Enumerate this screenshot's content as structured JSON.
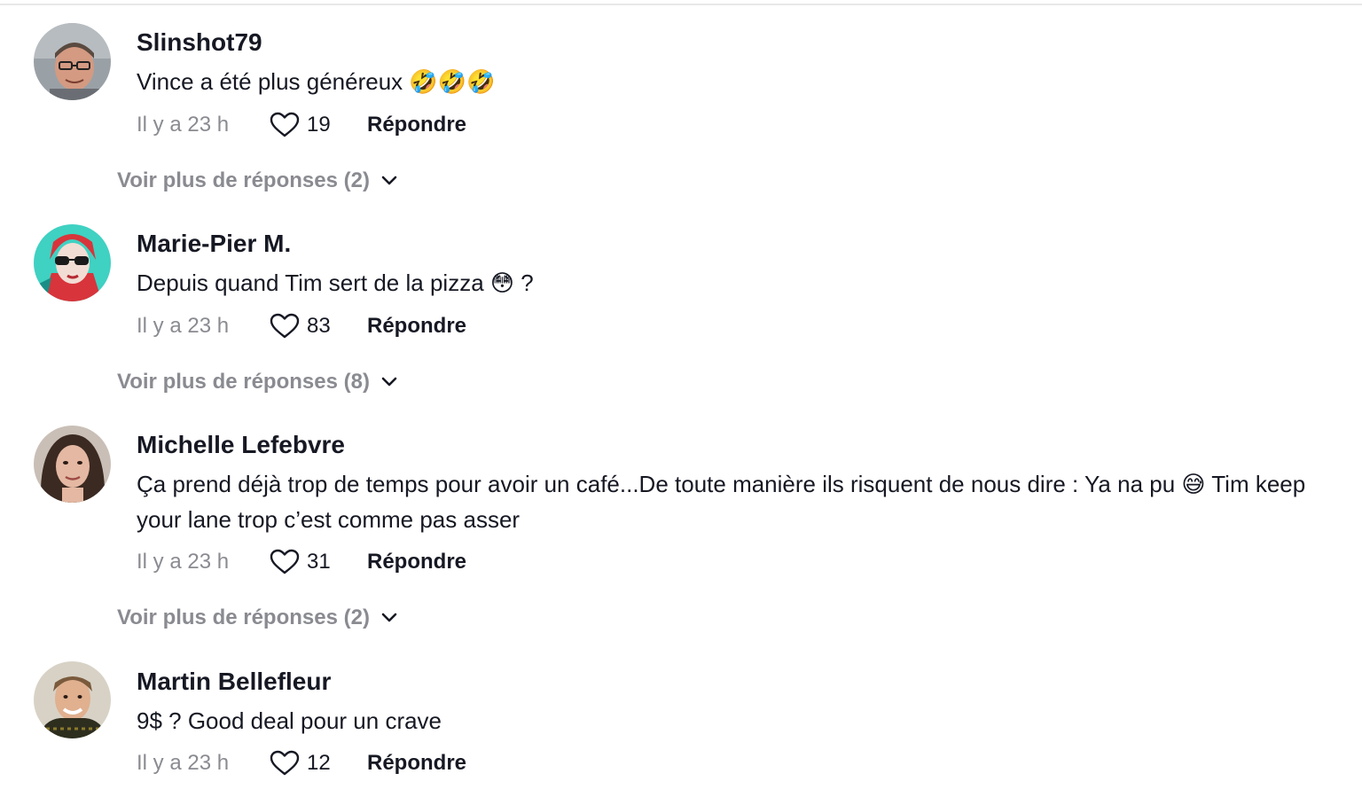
{
  "reply_label": "Répondre",
  "comments": [
    {
      "username": "Slinshot79",
      "text": "Vince a été plus généreux 🤣🤣🤣",
      "timestamp": "Il y a 23 h",
      "likes": "19",
      "more_replies": "Voir plus de réponses (2)",
      "avatar_icon": "man-with-glasses-avatar"
    },
    {
      "username": "Marie-Pier M.",
      "text": "Depuis quand Tim sert de la pizza 😳 ?",
      "timestamp": "Il y a 23 h",
      "likes": "83",
      "more_replies": "Voir plus de réponses (8)",
      "avatar_icon": "woman-red-sunglasses-avatar"
    },
    {
      "username": "Michelle Lefebvre",
      "text": "Ça prend déjà trop de temps pour avoir un café...De toute manière ils risquent de nous dire : Ya na pu 😅 Tim keep your lane trop c’est comme pas asser",
      "timestamp": "Il y a 23 h",
      "likes": "31",
      "more_replies": "Voir plus de réponses (2)",
      "avatar_icon": "woman-dark-hair-avatar"
    },
    {
      "username": "Martin Bellefleur",
      "text": "9$ ? Good deal pour un crave",
      "timestamp": "Il y a 23 h",
      "likes": "12",
      "avatar_icon": "man-smiling-avatar"
    }
  ],
  "colors": {
    "primary_text": "#161823",
    "secondary_text": "#8a8b91",
    "background": "#ffffff"
  }
}
